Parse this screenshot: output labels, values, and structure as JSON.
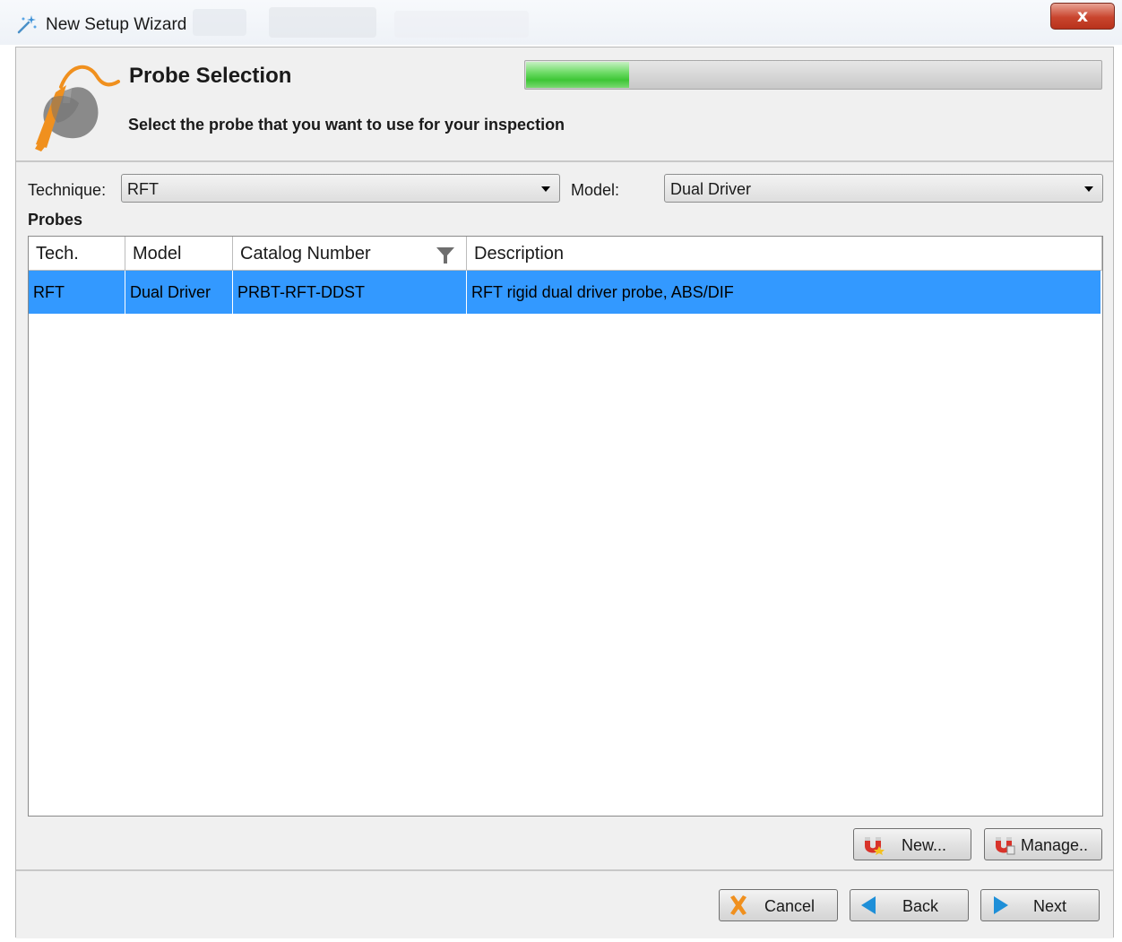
{
  "window": {
    "title": "New Setup Wizard",
    "close_label": "x"
  },
  "header": {
    "title": "Probe Selection",
    "subtitle": "Select the probe that you want to use for your inspection",
    "progress_fraction": 0.18
  },
  "filters": {
    "technique_label": "Technique:",
    "technique_value": "RFT",
    "model_label": "Model:",
    "model_value": "Dual Driver"
  },
  "probes": {
    "section_label": "Probes",
    "columns": [
      "Tech.",
      "Model",
      "Catalog Number",
      "Description"
    ],
    "rows": [
      [
        "RFT",
        "Dual Driver",
        "PRBT-RFT-DDST",
        "RFT rigid dual driver probe, ABS/DIF"
      ]
    ],
    "selected_row": 0
  },
  "probe_actions": {
    "new_label": "New...",
    "manage_label": "Manage.."
  },
  "navigation": {
    "cancel_label": "Cancel",
    "back_label": "Back",
    "next_label": "Next"
  },
  "colors": {
    "selection": "#3399ff",
    "accent_orange": "#f0901e",
    "progress_green": "#3ec636"
  },
  "icons": {
    "window": "wizard-wand-icon",
    "header": "probe-hand-icon",
    "filter": "funnel-icon",
    "new": "magnet-icon",
    "manage": "magnet-icon",
    "cancel": "x-icon",
    "back": "triangle-left-icon",
    "next": "triangle-right-icon"
  }
}
